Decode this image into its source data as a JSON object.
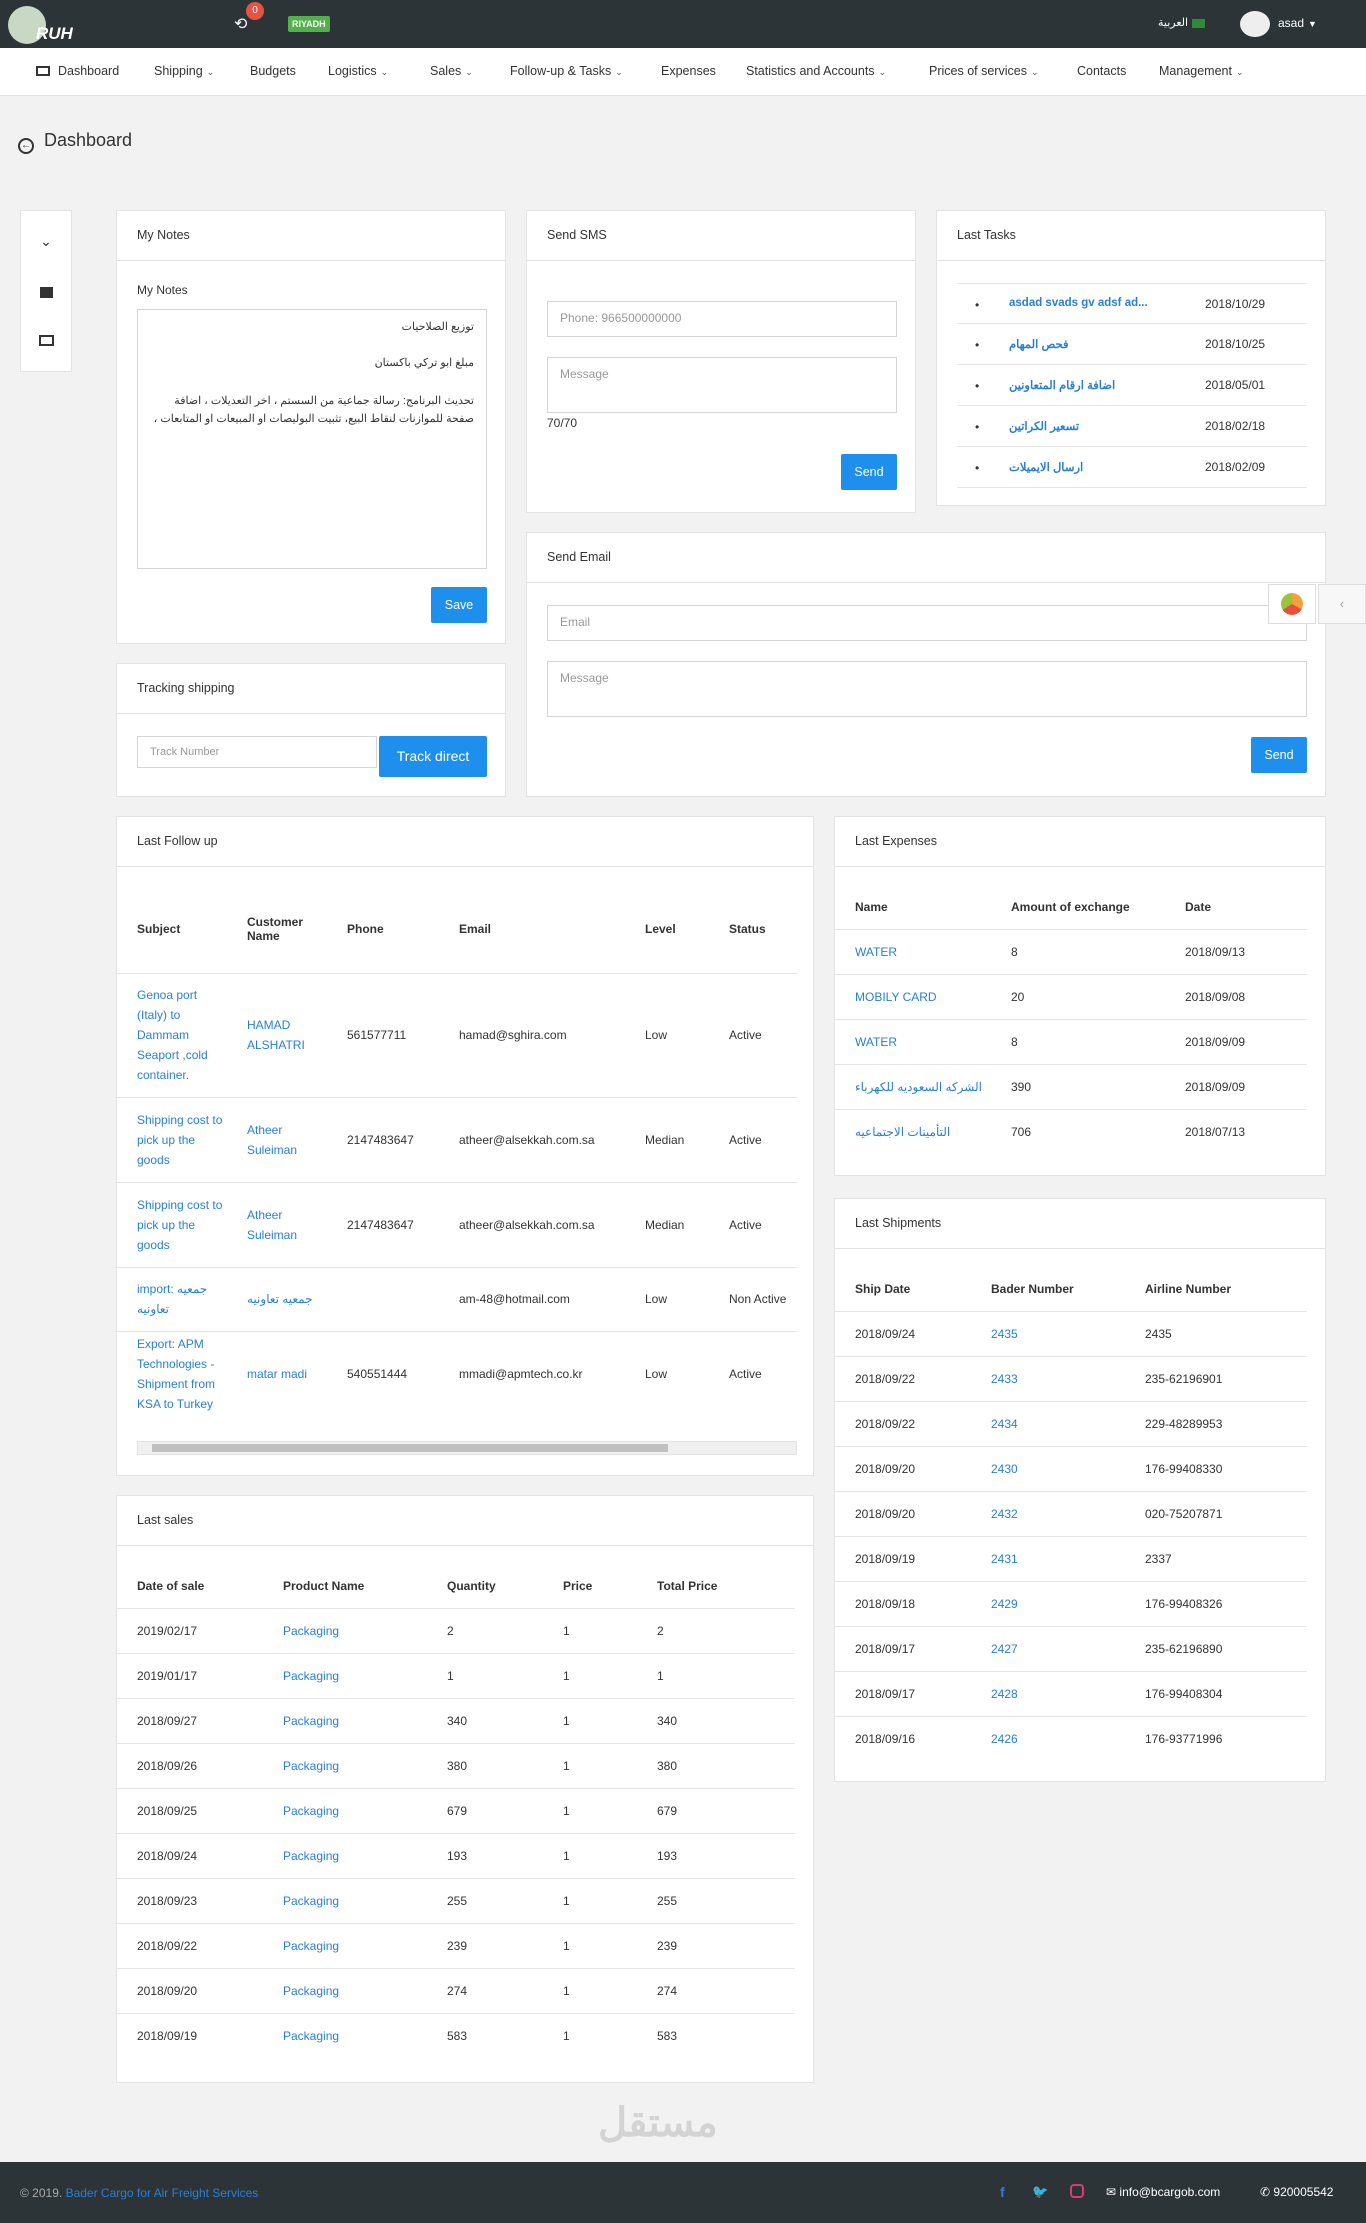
{
  "header": {
    "logo_text": "RUH",
    "notif_count": "0",
    "branch": "RIYADH",
    "lang": "العربية",
    "user": "asad"
  },
  "nav": [
    "Dashboard",
    "Shipping",
    "Budgets",
    "Logistics",
    "Sales",
    "Follow-up & Tasks",
    "Expenses",
    "Statistics and Accounts",
    "Prices of services",
    "Contacts",
    "Management"
  ],
  "page_title": "Dashboard",
  "notes": {
    "title": "My Notes",
    "label": "My Notes",
    "line1": "توزيع الصلاحيات",
    "line2": "مبلغ ابو تركي باكستان",
    "line3": "تحديث البرنامج: رسالة جماعية من السستم ، اخر التعديلات ، اضافة صفحة للموازنات لنقاط البيع، تثبيت البوليصات او المبيعات او المتابعات ،",
    "save": "Save"
  },
  "tracking": {
    "title": "Tracking shipping",
    "placeholder": "Track Number",
    "button": "Track direct"
  },
  "sms": {
    "title": "Send SMS",
    "phone_placeholder": "Phone: 966500000000",
    "msg_placeholder": "Message",
    "counter": "70/70",
    "send": "Send"
  },
  "email": {
    "title": "Send Email",
    "email_placeholder": "Email",
    "msg_placeholder": "Message",
    "send": "Send"
  },
  "tasks": {
    "title": "Last Tasks",
    "items": [
      {
        "name": "asdad svads gv adsf ad...",
        "date": "2018/10/29"
      },
      {
        "name": "فحص المهام",
        "date": "2018/10/25"
      },
      {
        "name": "اضافة ارقام المتعاونين",
        "date": "2018/05/01"
      },
      {
        "name": "تسعير الكراتين",
        "date": "2018/02/18"
      },
      {
        "name": "ارسال الايميلات",
        "date": "2018/02/09"
      }
    ]
  },
  "followup": {
    "title": "Last Follow up",
    "headers": [
      "Subject",
      "Customer Name",
      "Phone",
      "Email",
      "Level",
      "Status"
    ],
    "rows": [
      {
        "subject": "Genoa port (Italy) to Dammam Seaport ,cold container.",
        "customer": "HAMAD ALSHATRI",
        "phone": "561577711",
        "email": "hamad@sghira.com",
        "level": "Low",
        "status": "Active"
      },
      {
        "subject": "Shipping cost to pick up the goods",
        "customer": "Atheer Suleiman",
        "phone": "2147483647",
        "email": "atheer@alsekkah.com.sa",
        "level": "Median",
        "status": "Active"
      },
      {
        "subject": "Shipping cost to pick up the goods",
        "customer": "Atheer Suleiman",
        "phone": "2147483647",
        "email": "atheer@alsekkah.com.sa",
        "level": "Median",
        "status": "Active"
      },
      {
        "subject": "import: جمعيه تعاونيه",
        "customer": "جمعيه تعاونيه",
        "phone": "",
        "email": "am-48@hotmail.com",
        "level": "Low",
        "status": "Non Active"
      },
      {
        "subject": "Export: APM Technologies - Shipment from KSA to Turkey",
        "customer": "matar madi",
        "phone": "540551444",
        "email": "mmadi@apmtech.co.kr",
        "level": "Low",
        "status": "Active"
      }
    ]
  },
  "expenses": {
    "title": "Last Expenses",
    "headers": [
      "Name",
      "Amount of exchange",
      "Date"
    ],
    "rows": [
      [
        "WATER",
        "8",
        "2018/09/13"
      ],
      [
        "MOBILY CARD",
        "20",
        "2018/09/08"
      ],
      [
        "WATER",
        "8",
        "2018/09/09"
      ],
      [
        "الشركه السعوديه للكهرباء",
        "390",
        "2018/09/09"
      ],
      [
        "التأمينات الاجتماعيه",
        "706",
        "2018/07/13"
      ]
    ]
  },
  "shipments": {
    "title": "Last Shipments",
    "headers": [
      "Ship Date",
      "Bader Number",
      "Airline Number"
    ],
    "rows": [
      [
        "2018/09/24",
        "2435",
        "2435"
      ],
      [
        "2018/09/22",
        "2433",
        "235-62196901"
      ],
      [
        "2018/09/22",
        "2434",
        "229-48289953"
      ],
      [
        "2018/09/20",
        "2430",
        "176-99408330"
      ],
      [
        "2018/09/20",
        "2432",
        "020-75207871"
      ],
      [
        "2018/09/19",
        "2431",
        "2337"
      ],
      [
        "2018/09/18",
        "2429",
        "176-99408326"
      ],
      [
        "2018/09/17",
        "2427",
        "235-62196890"
      ],
      [
        "2018/09/17",
        "2428",
        "176-99408304"
      ],
      [
        "2018/09/16",
        "2426",
        "176-93771996"
      ]
    ]
  },
  "sales": {
    "title": "Last sales",
    "headers": [
      "Date of sale",
      "Product Name",
      "Quantity",
      "Price",
      "Total Price"
    ],
    "rows": [
      [
        "2019/02/17",
        "Packaging",
        "2",
        "1",
        "2"
      ],
      [
        "2019/01/17",
        "Packaging",
        "1",
        "1",
        "1"
      ],
      [
        "2018/09/27",
        "Packaging",
        "340",
        "1",
        "340"
      ],
      [
        "2018/09/26",
        "Packaging",
        "380",
        "1",
        "380"
      ],
      [
        "2018/09/25",
        "Packaging",
        "679",
        "1",
        "679"
      ],
      [
        "2018/09/24",
        "Packaging",
        "193",
        "1",
        "193"
      ],
      [
        "2018/09/23",
        "Packaging",
        "255",
        "1",
        "255"
      ],
      [
        "2018/09/22",
        "Packaging",
        "239",
        "1",
        "239"
      ],
      [
        "2018/09/20",
        "Packaging",
        "274",
        "1",
        "274"
      ],
      [
        "2018/09/19",
        "Packaging",
        "583",
        "1",
        "583"
      ]
    ]
  },
  "footer": {
    "copyright": "© 2019.",
    "company": "Bader Cargo for Air Freight Services",
    "email": "info@bcargob.com",
    "phone": "920005542"
  },
  "watermark": "مستقل"
}
